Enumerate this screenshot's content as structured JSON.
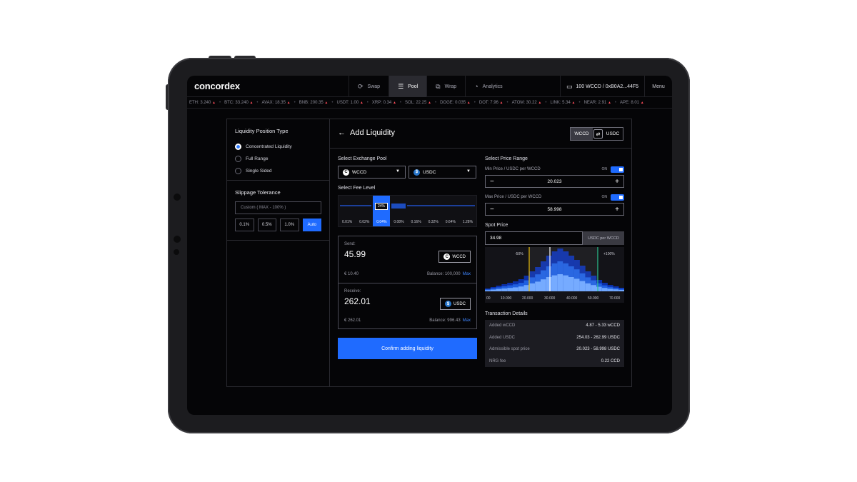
{
  "app": {
    "logo": "concordex",
    "tabs": [
      {
        "label": "Swap",
        "icon": "refresh-icon"
      },
      {
        "label": "Pool",
        "icon": "list-icon"
      },
      {
        "label": "Wrap",
        "icon": "wrap-icon"
      },
      {
        "label": "Analytics",
        "icon": "chart-icon"
      }
    ],
    "active_tab": "Pool",
    "wallet": "100 WCCD / 0xB0A2...44F5",
    "menu": "Menu"
  },
  "ticker": [
    {
      "sym": "ETH",
      "val": "3.240"
    },
    {
      "sym": "BTC",
      "val": "33.240"
    },
    {
      "sym": "AVAX",
      "val": "18.35"
    },
    {
      "sym": "BNB",
      "val": "200.35"
    },
    {
      "sym": "USDT",
      "val": "1.00"
    },
    {
      "sym": "XRP",
      "val": "0.34"
    },
    {
      "sym": "SOL",
      "val": "22.25"
    },
    {
      "sym": "DOGE",
      "val": "0.035"
    },
    {
      "sym": "DOT",
      "val": "7.96"
    },
    {
      "sym": "ATOM",
      "val": "30.22"
    },
    {
      "sym": "LINK",
      "val": "5.34"
    },
    {
      "sym": "NEAR",
      "val": "2.91"
    },
    {
      "sym": "APE",
      "val": "8.01"
    }
  ],
  "left": {
    "position_title": "Liquidity Position Type",
    "options": [
      "Concentrated Liquidity",
      "Full Range",
      "Single Sided"
    ],
    "selected_option": "Concentrated Liquidity",
    "slippage_title": "Slippage Tolerance",
    "slippage_placeholder": "Custom ( MAX - 100% )",
    "slippage_buttons": [
      "0.1%",
      "0.5%",
      "1.0%",
      "Auto"
    ],
    "slippage_selected": "Auto"
  },
  "add": {
    "title": "Add Liquidity",
    "pair_a": "WCCD",
    "pair_b": "USDC",
    "pool_title": "Select Exchange Pool",
    "pool_token_a": "WCCD",
    "pool_token_b": "USDC",
    "fee_title": "Select Fee Level",
    "fee_levels": [
      "0.01%",
      "0.02%",
      "0.04%",
      "0.08%",
      "0.16%",
      "0.32%",
      "0.64%",
      "1.28%"
    ],
    "fee_selected": "0.04%",
    "fee_tooltip": "24%",
    "send": {
      "label": "Send:",
      "amount": "45.99",
      "token": "WCCD",
      "eur": "€ 10.40",
      "balance": "Balance: 100,000",
      "max": "Max"
    },
    "receive": {
      "label": "Receive:",
      "amount": "262.01",
      "token": "USDC",
      "eur": "€ 262.01",
      "balance": "Balance: 996.43",
      "max": "Max"
    },
    "confirm": "Confirm adding liquidity"
  },
  "price": {
    "title": "Select Price Range",
    "min_label": "Min Price / USDC per WCCD",
    "min_value": "20.023",
    "max_label": "Max Price / USDC per WCCD",
    "max_value": "58.998",
    "toggle_label": "ON",
    "spot_title": "Spot Price",
    "spot_value": "34.98",
    "spot_unit": "USDC per WCCD",
    "hist_low_label": "-50%",
    "hist_high_label": "+100%",
    "hist_ticks": [
      "00",
      "10.000",
      "20.000",
      "30.000",
      "40.000",
      "50.000",
      "70.000"
    ],
    "details_title": "Transaction Details",
    "details": [
      {
        "k": "Added wCCD",
        "v": "4.87 - 5.33 wCCD"
      },
      {
        "k": "Added USDC",
        "v": "254.03 - 262.99  USDC"
      },
      {
        "k": "Admissible spot price",
        "v": "20.023 - 58.998 USDC"
      },
      {
        "k": "NRG fee",
        "v": "0.22 CCD"
      }
    ]
  },
  "colors": {
    "accent": "#1f6bff",
    "bg": "#050507",
    "panel": "#1c1c22",
    "up": "#ff4d5a"
  }
}
